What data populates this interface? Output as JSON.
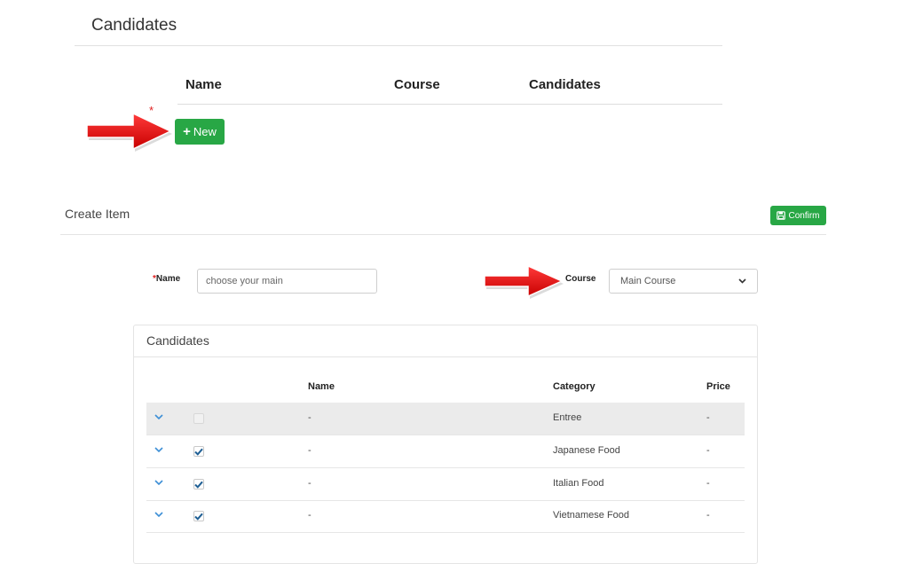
{
  "top": {
    "title": "Candidates",
    "headers": [
      "Name",
      "Course",
      "Candidates"
    ],
    "required_marker": "*",
    "new_button": "New"
  },
  "create": {
    "title": "Create Item",
    "confirm_button": "Confirm",
    "name_label": "Name",
    "name_required_marker": "*",
    "name_placeholder": "choose your main",
    "course_label": "Course",
    "course_selected": "Main Course"
  },
  "candidates": {
    "title": "Candidates",
    "headers": {
      "name": "Name",
      "category": "Category",
      "price": "Price"
    },
    "rows": [
      {
        "name": "-",
        "category": "Entree",
        "price": "-",
        "checked": false,
        "disabled": true
      },
      {
        "name": "-",
        "category": "Japanese Food",
        "price": "-",
        "checked": true,
        "disabled": false
      },
      {
        "name": "-",
        "category": "Italian Food",
        "price": "-",
        "checked": true,
        "disabled": false
      },
      {
        "name": "-",
        "category": "Vietnamese Food",
        "price": "-",
        "checked": true,
        "disabled": false
      }
    ]
  },
  "colors": {
    "accent_green": "#28a745",
    "annotation_red": "#e8191b",
    "link_blue": "#3d8fd6"
  },
  "icons": [
    "plus-icon",
    "save-icon",
    "chevron-down-icon",
    "checkmark-icon",
    "red-arrow-annotation"
  ]
}
